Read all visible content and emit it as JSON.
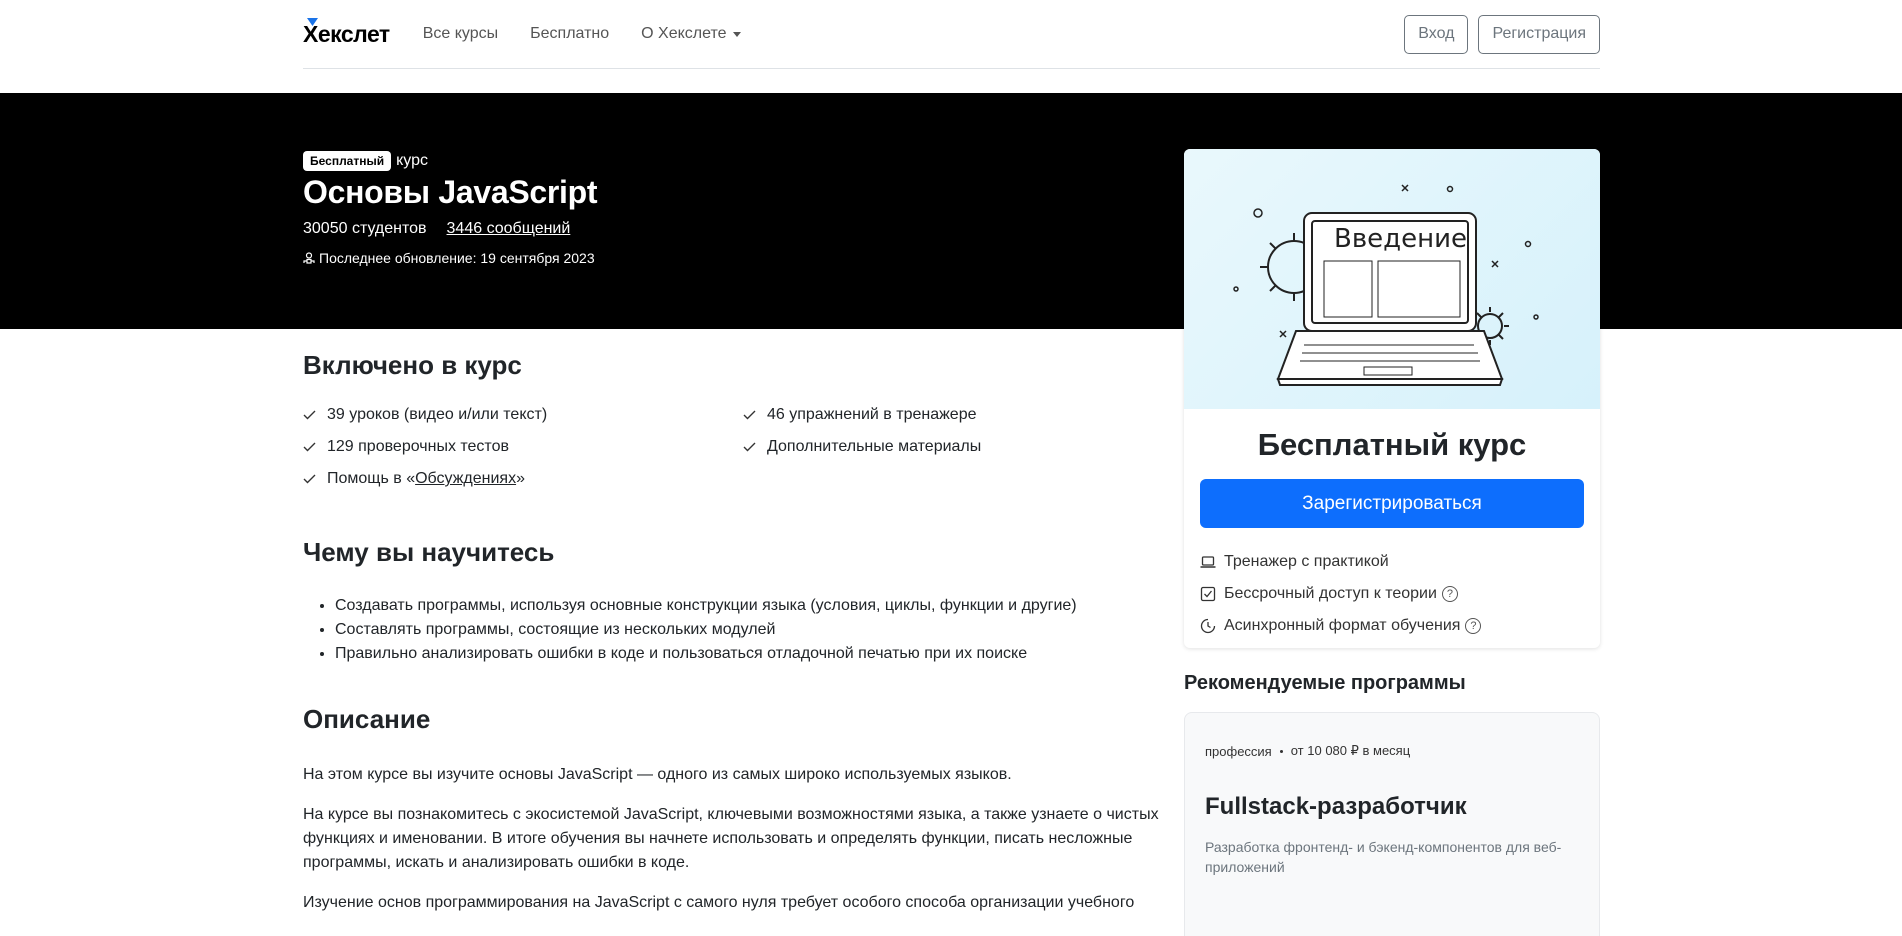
{
  "nav": {
    "logo": "Хекслет",
    "links": [
      "Все курсы",
      "Бесплатно",
      "О Хекслете"
    ],
    "login": "Вход",
    "register": "Регистрация"
  },
  "hero": {
    "badge": "Бесплатный",
    "badge_suffix": "курс",
    "title": "Основы JavaScript",
    "students": "30050 студентов",
    "messages": "3446 сообщений",
    "updated": "Последнее обновление: 19 сентября 2023"
  },
  "card": {
    "image_text": "Введение",
    "title": "Бесплатный курс",
    "cta": "Зарегистрироваться",
    "features": [
      {
        "icon": "laptop-icon",
        "label": "Тренажер с практикой",
        "help": false
      },
      {
        "icon": "checkbox-icon",
        "label": "Бессрочный доступ к теории",
        "help": true
      },
      {
        "icon": "clock-icon",
        "label": "Асинхронный формат обучения",
        "help": true
      }
    ],
    "help_glyph": "?"
  },
  "recommended": {
    "title": "Рекомендуемые программы",
    "items": [
      {
        "type": "профессия",
        "price": "от 10 080 ₽ в месяц",
        "name": "Fullstack-разработчик",
        "desc": "Разработка фронтенд- и бэкенд-компонентов для веб-приложений"
      }
    ]
  },
  "included": {
    "title": "Включено в курс",
    "items": [
      "39 уроков (видео и/или текст)",
      "46 упражнений в тренажере",
      "129 проверочных тестов",
      "Дополнительные материалы"
    ],
    "help_prefix": "Помощь в «",
    "help_link": "Обсуждениях",
    "help_suffix": "»"
  },
  "learn": {
    "title": "Чему вы научитесь",
    "items": [
      "Создавать программы, используя основные конструкции языка (условия, циклы, функции и другие)",
      "Составлять программы, состоящие из нескольких модулей",
      "Правильно анализировать ошибки в коде и пользоваться отладочной печатью при их поиске"
    ]
  },
  "description": {
    "title": "Описание",
    "paragraphs": [
      "На этом курсе вы изучите основы JavaScript — одного из самых широко используемых языков.",
      "На курсе вы познакомитесь с экосистемой JavaScript, ключевыми возможностями языка, а также узнаете о чистых функциях и именовании. В итоге обучения вы начнете использовать и определять функции, писать несложные программы, искать и анализировать ошибки в коде.",
      "Изучение основ программирования на JavaScript с самого нуля требует особого способа организации учебного"
    ]
  },
  "colors": {
    "primary": "#0d6efd",
    "hero_bg": "#000000"
  }
}
